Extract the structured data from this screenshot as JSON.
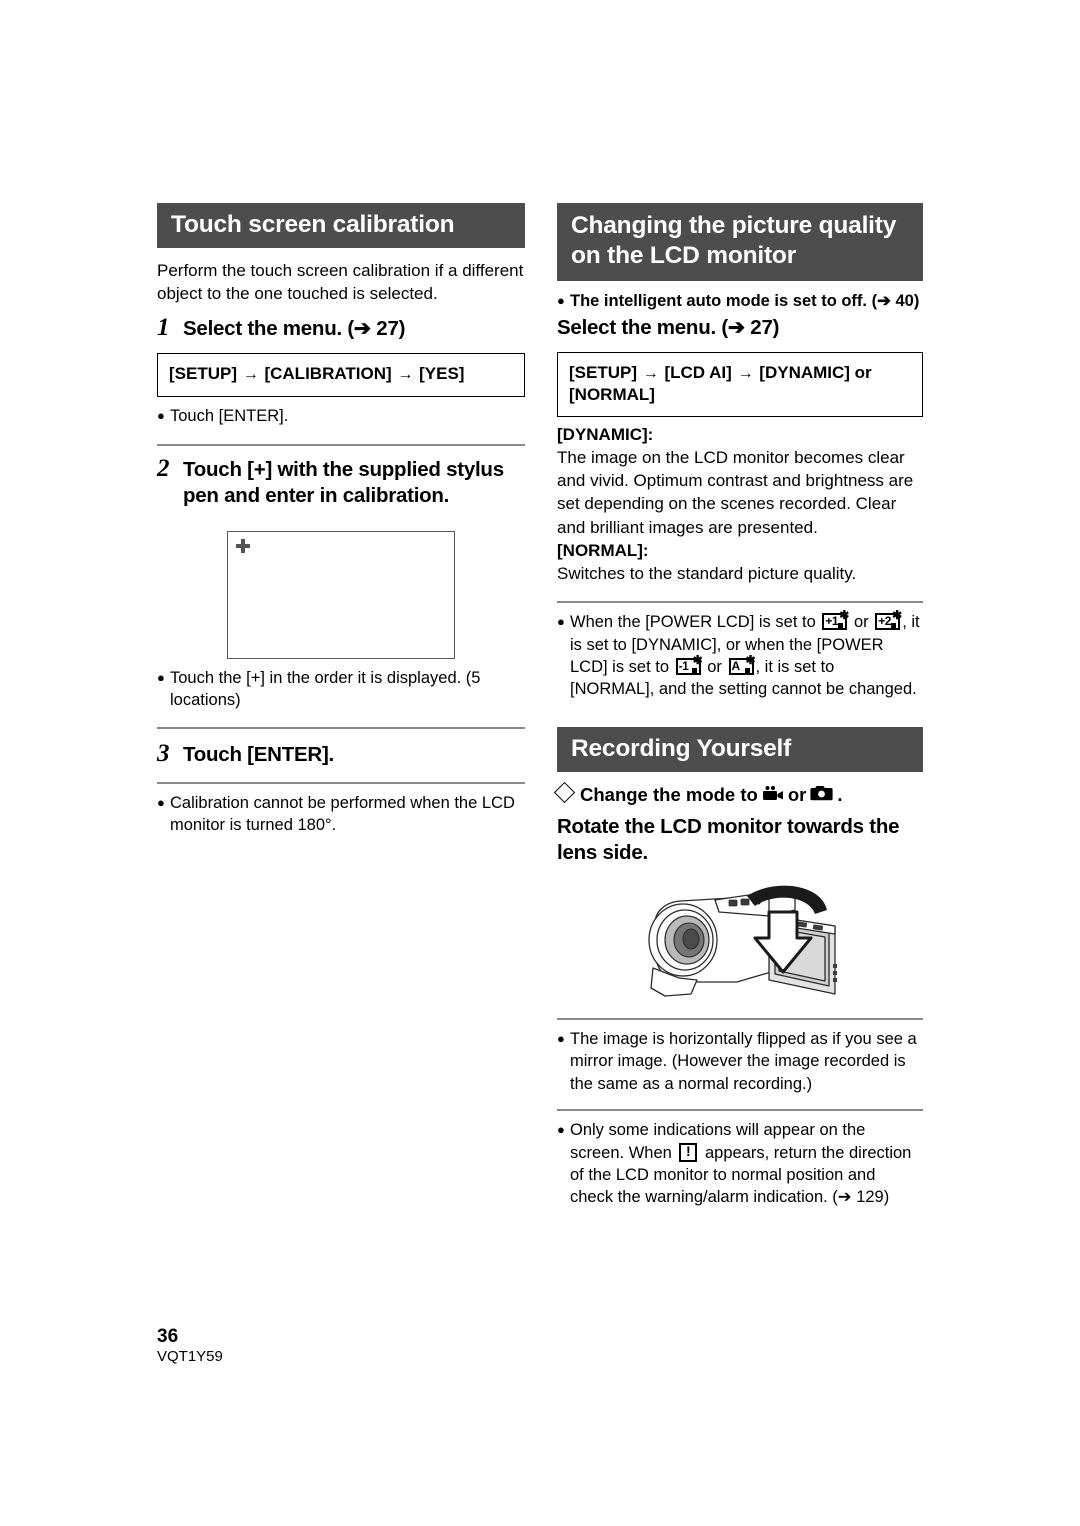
{
  "page": {
    "number": "36",
    "doc_code": "VQT1Y59"
  },
  "left_column": {
    "section_title": "Touch screen calibration",
    "intro": "Perform the touch screen calibration if a different object to the one touched is selected.",
    "steps": [
      {
        "num": "1",
        "text": "Select the menu. (➔ 27)"
      },
      {
        "num": "2",
        "text": "Touch [+] with the supplied stylus pen and enter in calibration."
      },
      {
        "num": "3",
        "text": "Touch [ENTER]."
      }
    ],
    "menu_box": {
      "part1": "[SETUP]",
      "arrow1": "→",
      "part2": "[CALIBRATION]",
      "arrow2": "→",
      "part3": "[YES]"
    },
    "bullet_enter": "Touch [ENTER].",
    "calibration_screen": {
      "cross_icon": "plus-crosshair-icon"
    },
    "bullet_order": "Touch the [+] in the order it is displayed. (5 locations)",
    "bullet_180": "Calibration cannot be performed when the LCD monitor is turned 180°."
  },
  "right_column": {
    "section_title_quality": "Changing the picture quality on the LCD monitor",
    "bullet_iauto": "The intelligent auto mode is set to off. (➔ 40)",
    "select_menu_head": "Select the menu. (➔ 27)",
    "menu_box": {
      "part1": "[SETUP]",
      "arrow1": "→",
      "part2": "[LCD AI]",
      "arrow2": "→",
      "part3": "[DYNAMIC] or [NORMAL]"
    },
    "dynamic_label": "[DYNAMIC]:",
    "dynamic_text": "The image on the LCD monitor becomes clear and vivid. Optimum contrast and brightness are set depending on the scenes recorded. Clear and brilliant images are presented.",
    "normal_label": "[NORMAL]:",
    "normal_text": "Switches to the standard picture quality.",
    "power_lcd_note": {
      "seg1": "When the [POWER LCD] is set to",
      "icon1": "lcd-plus1-icon",
      "icon1_label": "+1",
      "or1": "or",
      "icon2": "lcd-plus2-icon",
      "icon2_label": "+2",
      "seg2": ", it is set to [DYNAMIC], or when the [POWER LCD] is set to",
      "icon3": "lcd-minus1-icon",
      "icon3_label": "-1",
      "or2": "or",
      "icon4": "lcd-auto-icon",
      "icon4_label": "A",
      "seg3": ", it is set to [NORMAL], and the setting cannot be changed."
    },
    "section_title_recording": "Recording Yourself",
    "change_mode": {
      "prefix": "Change the mode to",
      "icon_video": "video-camera-mode-icon",
      "or": "or",
      "icon_photo": "still-camera-mode-icon",
      "suffix": "."
    },
    "rotate_head": "Rotate the LCD monitor towards the lens side.",
    "illustration": "camcorder-rotate-lcd-illustration",
    "bullet_mirror": "The image is horizontally flipped as if you see a mirror image. (However the image recorded is the same as a normal recording.)",
    "bullet_indications": {
      "seg1": "Only some indications will appear on the screen. When",
      "icon": "warning-exclamation-icon",
      "seg2": "appears, return the direction of the LCD monitor to normal position and check the warning/alarm indication. (➔ 129)"
    }
  }
}
